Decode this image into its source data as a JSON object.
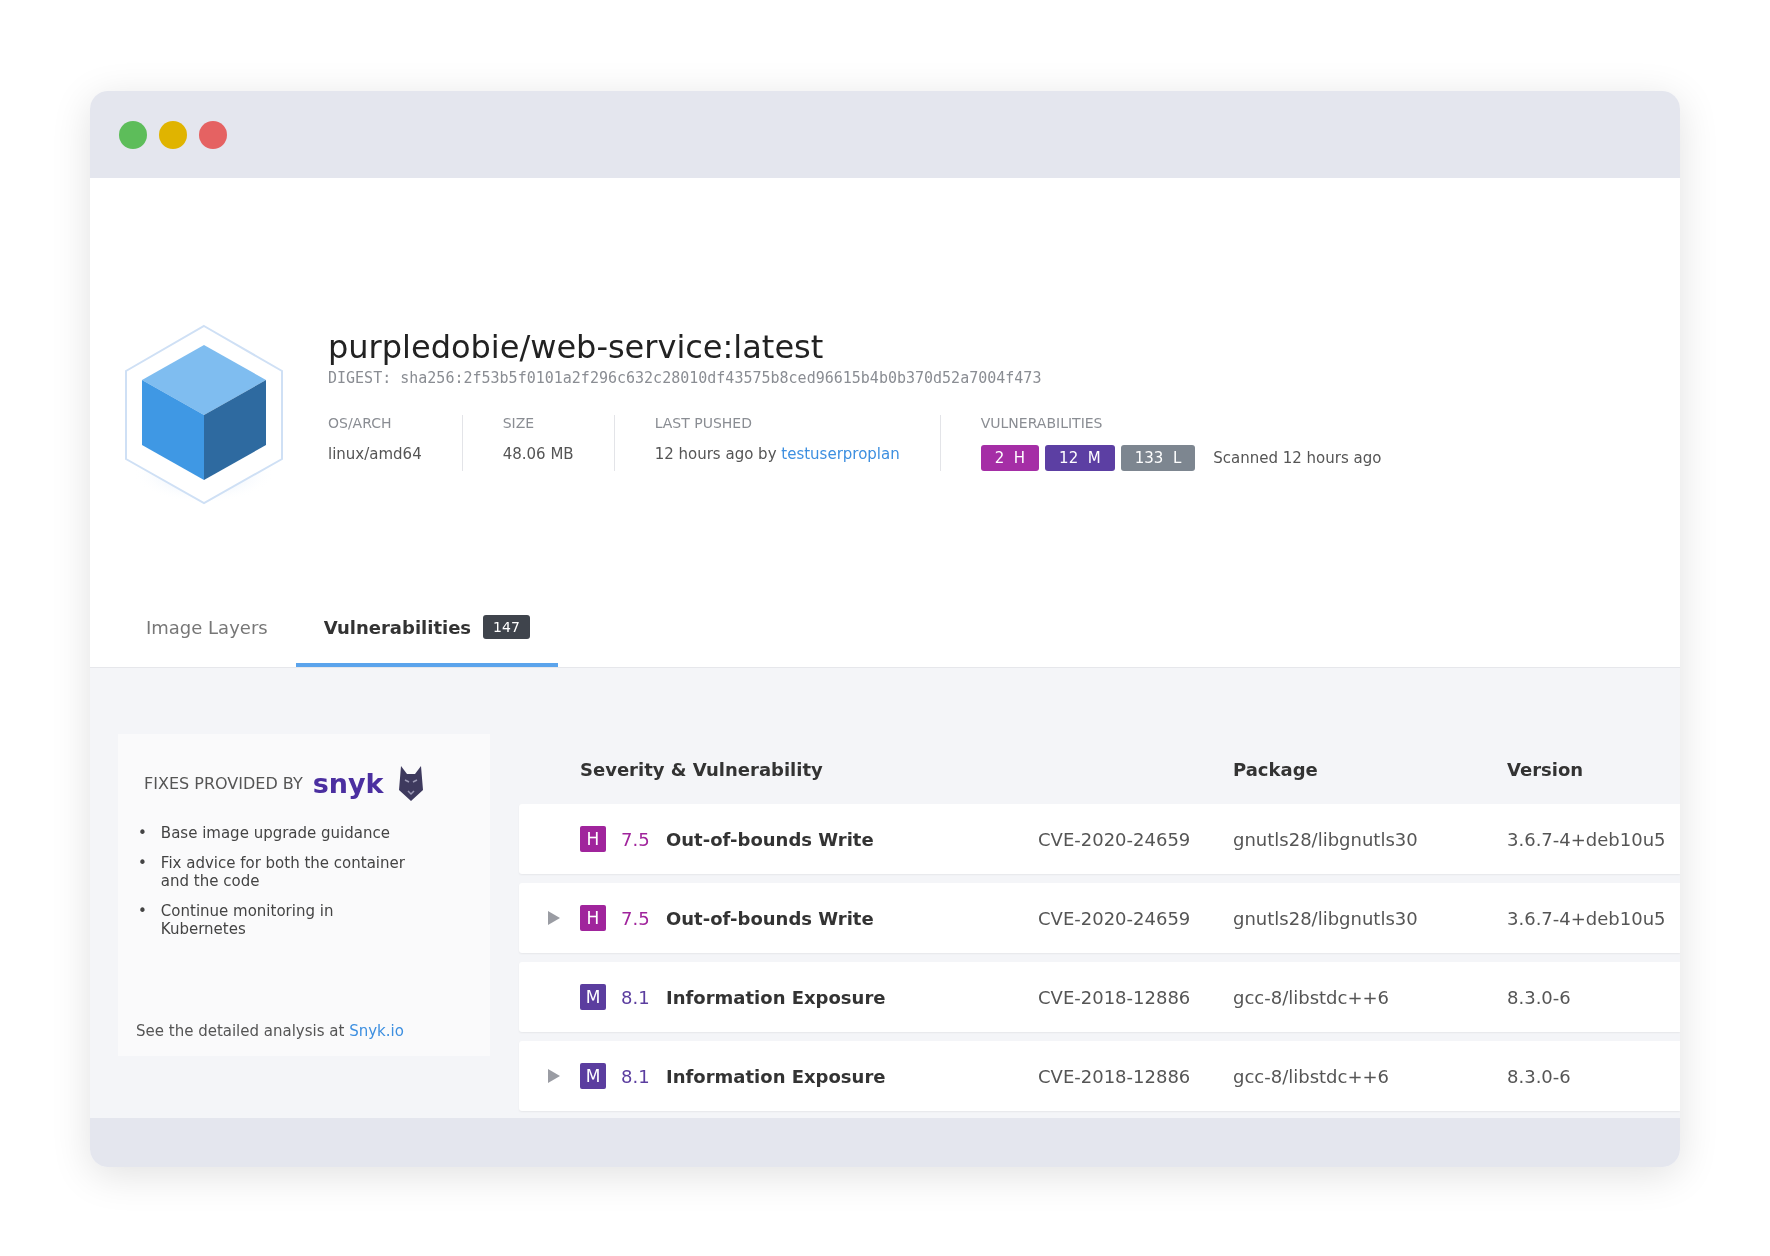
{
  "image": {
    "name": "purpledobie/web-service:latest",
    "digest": "DIGEST: sha256:2f53b5f0101a2f296c632c28010df43575b8ced96615b4b0b370d52a7004f473",
    "meta": [
      {
        "label": "OS/ARCH",
        "value": "linux/amd64"
      },
      {
        "label": "SIZE",
        "value": "48.06 MB"
      },
      {
        "label": "LAST PUSHED",
        "value": "12 hours ago by ",
        "link": "testuserproplan"
      }
    ],
    "vulnerabilities": {
      "label": "VULNERABILITIES",
      "chips": [
        {
          "count": "2",
          "letter": "H",
          "color": "#a52ea6"
        },
        {
          "count": "12",
          "letter": "M",
          "color": "#5c3fa3"
        },
        {
          "count": "133",
          "letter": "L",
          "color": "#7d8690"
        }
      ],
      "scanned": "Scanned 12 hours ago"
    }
  },
  "tabs": [
    {
      "label": "Image Layers",
      "selected": false
    },
    {
      "label": "Vulnerabilities",
      "selected": true,
      "count": "147"
    }
  ],
  "snyk_panel": {
    "heading": "FIXES PROVIDED BY",
    "brand": "snyk",
    "marker": "•",
    "bullets": [
      "Base image upgrade guidance",
      "Fix advice for both the container and the code",
      "Continue monitoring in Kubernetes"
    ],
    "footer": "See the detailed analysis at ",
    "link": "Snyk.io"
  },
  "table": {
    "columns": [
      "Severity & Vulnerability",
      "Package",
      "Version"
    ],
    "rows": [
      {
        "expandable": false,
        "severity": "H",
        "color": "#a0249c",
        "score": "7.5",
        "name": "Out-of-bounds Write",
        "cve": "CVE-2020-24659",
        "package": "gnutls28/libgnutls30",
        "version": "3.6.7-4+deb10u5"
      },
      {
        "expandable": true,
        "severity": "H",
        "color": "#a0249c",
        "score": "7.5",
        "name": "Out-of-bounds Write",
        "cve": "CVE-2020-24659",
        "package": "gnutls28/libgnutls30",
        "version": "3.6.7-4+deb10u5"
      },
      {
        "expandable": false,
        "severity": "M",
        "color": "#5b3d9f",
        "score": "8.1",
        "name": "Information Exposure",
        "cve": "CVE-2018-12886",
        "package": "gcc-8/libstdc++6",
        "version": "8.3.0-6"
      },
      {
        "expandable": true,
        "severity": "M",
        "color": "#5b3d9f",
        "score": "8.1",
        "name": "Information Exposure",
        "cve": "CVE-2018-12886",
        "package": "gcc-8/libstdc++6",
        "version": "8.3.0-6"
      }
    ]
  }
}
